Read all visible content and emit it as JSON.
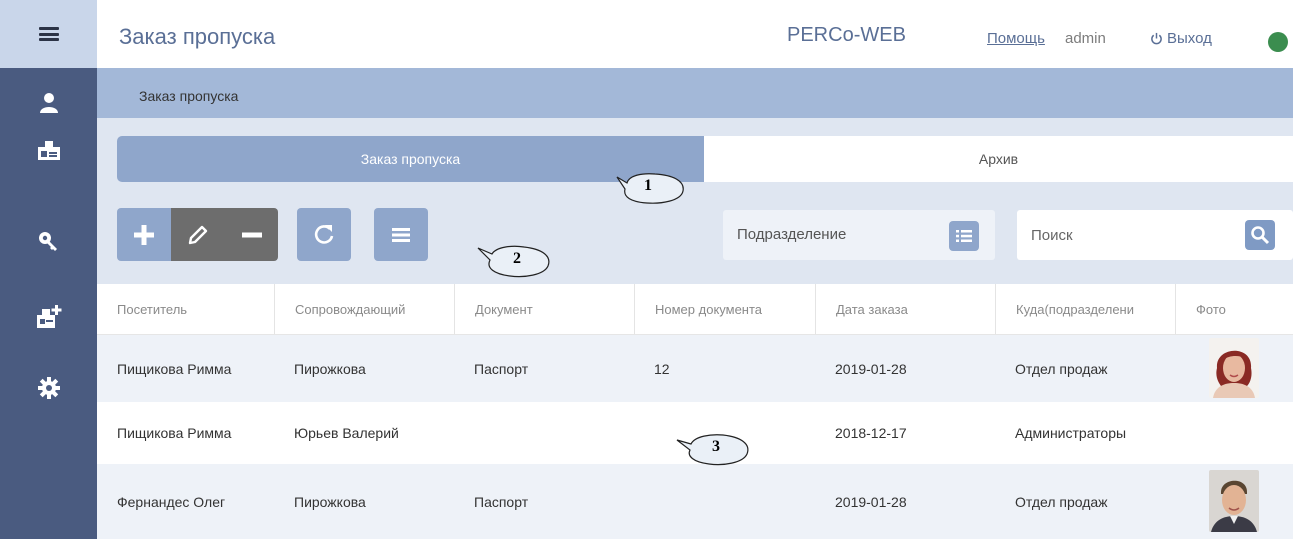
{
  "header": {
    "title": "Заказ пропуска",
    "brand": "PERCo-WEB",
    "help": "Помощь",
    "user": "admin",
    "logout": "Выход",
    "status_color": "#3b8d4f"
  },
  "sidebar": {
    "items": [
      {
        "icon": "hamburger-menu-icon"
      },
      {
        "icon": "visitor-person-icon"
      },
      {
        "icon": "pass-card-icon"
      },
      {
        "icon": "key-icon"
      },
      {
        "icon": "add-pass-icon"
      },
      {
        "icon": "gear-icon"
      }
    ]
  },
  "breadcrumb": "Заказ пропуска",
  "tabs": [
    {
      "label": "Заказ пропуска",
      "active": true
    },
    {
      "label": "Архив",
      "active": false
    }
  ],
  "toolbar": {
    "add": "add-icon",
    "edit": "pencil-icon",
    "remove": "minus-icon",
    "refresh": "refresh-icon",
    "columns": "list-icon"
  },
  "filter": {
    "department_label": "Подразделение"
  },
  "search": {
    "placeholder": "Поиск"
  },
  "table": {
    "columns": [
      "Посетитель",
      "Сопровождающий",
      "Документ",
      "Номер документа",
      "Дата заказа",
      "Куда(подразделени",
      "Фото"
    ],
    "rows": [
      {
        "visitor": "Пищикова Римма",
        "escort": "Пирожкова",
        "document": "Паспорт",
        "doc_number": "12",
        "date": "2019-01-28",
        "dept": "Отдел продаж",
        "photo": "female"
      },
      {
        "visitor": "Пищикова Римма",
        "escort": "Юрьев Валерий",
        "document": "",
        "doc_number": "",
        "date": "2018-12-17",
        "dept": "Администраторы",
        "photo": ""
      },
      {
        "visitor": "Фернандес Олег",
        "escort": "Пирожкова",
        "document": "Паспорт",
        "doc_number": "",
        "date": "2019-01-28",
        "dept": "Отдел продаж",
        "photo": "male"
      }
    ]
  },
  "callouts": [
    "1",
    "2",
    "3"
  ],
  "colors": {
    "sidebar": "#4a5b80",
    "accent": "#8fa6cb",
    "breadcrumb_bar": "#a3b8d8",
    "content_bg": "#dfe6f1"
  }
}
